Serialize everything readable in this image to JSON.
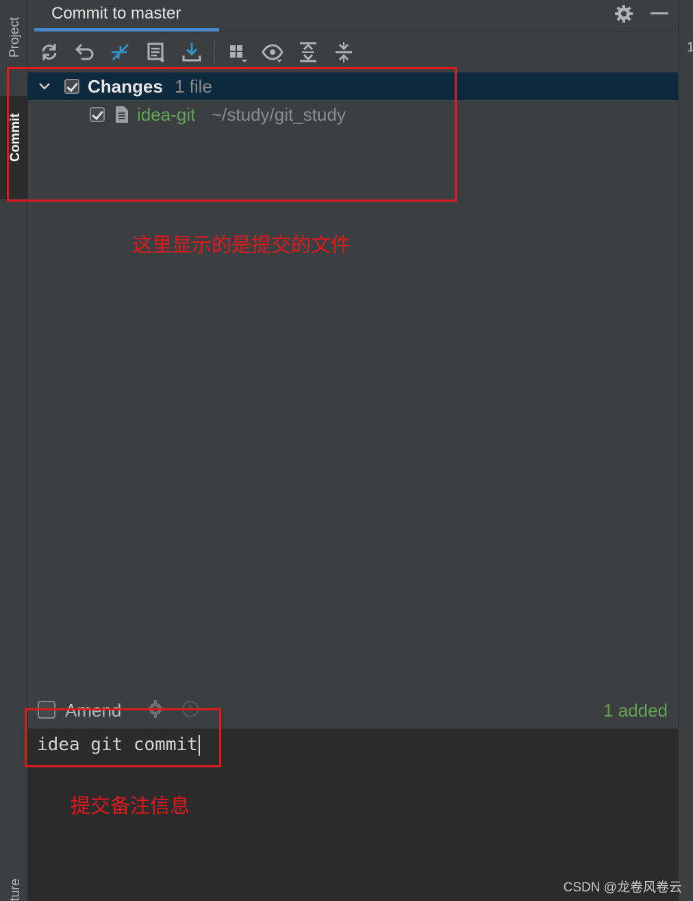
{
  "stripe": {
    "left_tabs": [
      "Project",
      "Commit",
      "ture"
    ],
    "right_marker": "1"
  },
  "header": {
    "title": "Commit to master",
    "settings_icon": "gear-icon",
    "minimize_icon": "minimize-icon"
  },
  "toolbar": {
    "buttons": [
      "refresh-icon",
      "rollback-icon",
      "show-diff-icon",
      "commit-details-icon",
      "shelve-download-icon",
      "group-by-icon",
      "view-options-icon",
      "expand-all-icon",
      "collapse-all-icon"
    ],
    "accent_color": "#3592c4"
  },
  "tree": {
    "group_label": "Changes",
    "group_count": "1 file",
    "group_checked": true,
    "files": [
      {
        "name": "idea-git",
        "path": "~/study/git_study",
        "checked": true,
        "status_color": "#62a354"
      }
    ]
  },
  "options": {
    "amend_label": "Amend",
    "amend_checked": false,
    "summary": "1 added"
  },
  "editor": {
    "message": "idea git commit"
  },
  "annotations": {
    "files_note": "这里显示的是提交的文件",
    "message_note": "提交备注信息",
    "color": "#e0191c"
  },
  "watermark": "CSDN @龙卷风卷云"
}
